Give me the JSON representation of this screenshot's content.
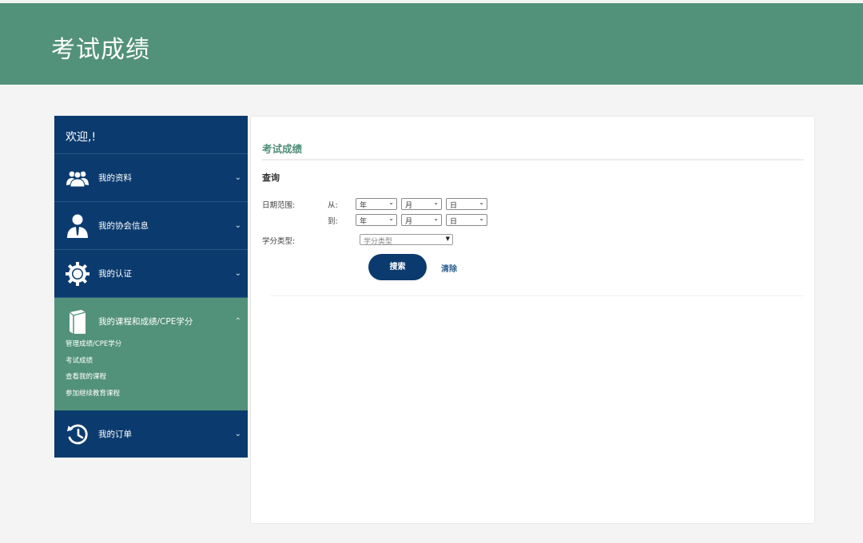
{
  "header": {
    "title": "考试成绩"
  },
  "sidebar": {
    "welcome": "欢迎,!",
    "items": [
      {
        "label": "我的资料",
        "icon": "users-icon"
      },
      {
        "label": "我的协会信息",
        "icon": "person-icon"
      },
      {
        "label": "我的认证",
        "icon": "gear-icon"
      },
      {
        "label": "我的课程和成绩/CPE学分",
        "icon": "book-icon",
        "children": [
          "管理成绩/CPE学分",
          "考试成绩",
          "查看我的课程",
          "参加继续教育课程"
        ]
      },
      {
        "label": "我的订单",
        "icon": "history-icon"
      }
    ],
    "colors": {
      "nav": "#0b3b6e",
      "active": "#52917a"
    }
  },
  "main": {
    "title": "考试成绩",
    "section": "查询",
    "date_range_label": "日期范围:",
    "from_label": "从:",
    "to_label": "到:",
    "year": "年",
    "month": "月",
    "day": "日",
    "credit_type_label": "学分类型:",
    "credit_type_value": "学分类型",
    "search_button": "搜索",
    "clear_link": "清除"
  }
}
